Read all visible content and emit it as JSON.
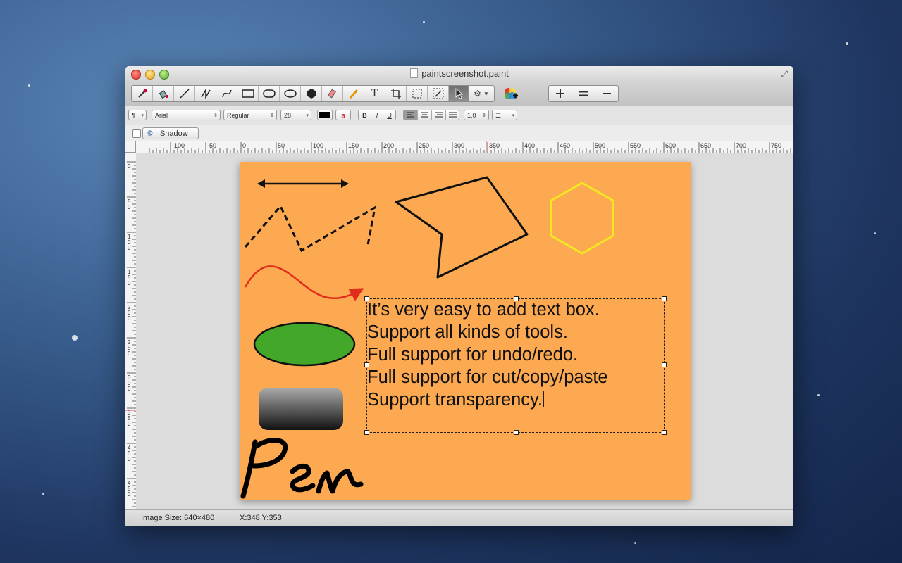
{
  "window": {
    "title": "paintscreenshot.paint"
  },
  "format": {
    "paragraph_style": "¶",
    "font_family": "Arial",
    "font_style": "Regular",
    "font_size": "28",
    "text_color_label": "a",
    "bold": "B",
    "italic": "I",
    "underline": "U",
    "line_spacing": "1.0"
  },
  "shadow": {
    "label": "Shadow",
    "checked": false
  },
  "ruler": {
    "h_labels": [
      "-100",
      "-50",
      "0",
      "50",
      "100",
      "150",
      "200",
      "250",
      "300",
      "350",
      "400",
      "450",
      "500",
      "550",
      "600",
      "650",
      "700",
      "750"
    ],
    "v_labels": [
      "0",
      "50",
      "100",
      "150",
      "200",
      "250",
      "300",
      "350",
      "400",
      "450"
    ]
  },
  "canvas": {
    "background": "#fca951",
    "text_lines": [
      "It’s very easy to add text box.",
      "Support all kinds of tools.",
      "Full support for undo/redo.",
      "Full support for cut/copy/paste",
      "Support transparency."
    ],
    "pen_text": "Pen"
  },
  "status": {
    "image_size": "Image Size: 640×480",
    "coords": "X:348 Y:353"
  },
  "colors": {
    "accent_red": "#e02d1c",
    "fill_green": "#43a82a",
    "hexagon_yellow": "#f4e622"
  }
}
